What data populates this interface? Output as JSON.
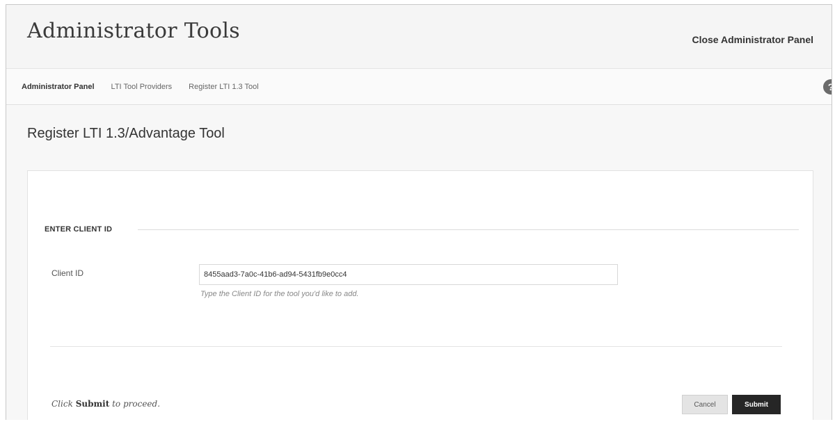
{
  "header": {
    "title": "Administrator Tools",
    "close_label": "Close Administrator Panel"
  },
  "breadcrumb": {
    "items": [
      "Administrator Panel",
      "LTI Tool Providers",
      "Register LTI 1.3 Tool"
    ],
    "help_icon": "help-icon"
  },
  "page": {
    "title": "Register LTI 1.3/Advantage Tool"
  },
  "form": {
    "section_label": "ENTER CLIENT ID",
    "client_id_label": "Client ID",
    "client_id_value": "8455aad3-7a0c-41b6-ad94-5431fb9e0cc4",
    "client_id_hint": "Type the Client ID for the tool you'd like to add.",
    "footer_prefix": "Click",
    "footer_bold": "Submit",
    "footer_suffix": "to proceed.",
    "cancel_label": "Cancel",
    "submit_label": "Submit"
  }
}
